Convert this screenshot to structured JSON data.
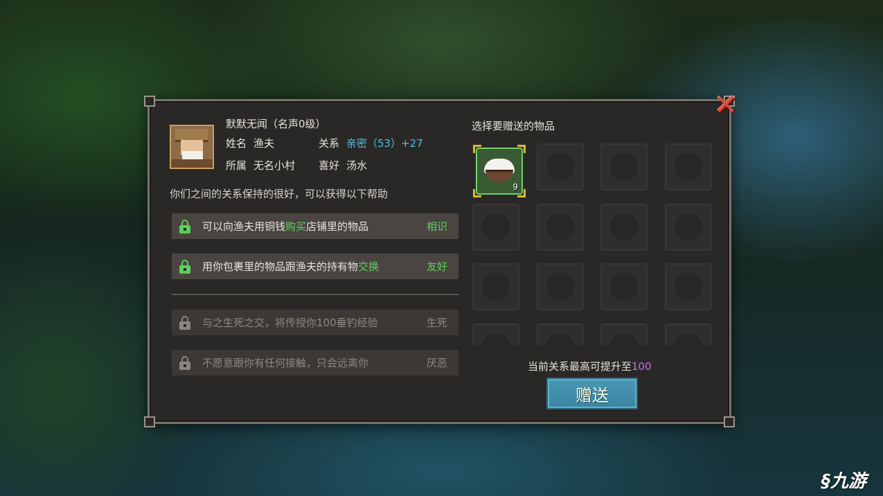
{
  "npc": {
    "title": "默默无闻（名声0级）",
    "name_label": "姓名",
    "name": "渔夫",
    "relation_label": "关系",
    "relation_value": "亲密（53）+27",
    "affiliation_label": "所属",
    "affiliation": "无名小村",
    "likes_label": "喜好",
    "likes": "汤水"
  },
  "description": "你们之间的关系保持的很好，可以获得以下帮助",
  "benefits": [
    {
      "pre": "可以向渔夫用铜钱",
      "highlight": "购买",
      "post": "店铺里的物品",
      "tag": "相识",
      "unlocked": true
    },
    {
      "pre": "用你包裹里的物品跟渔夫的持有物",
      "highlight": "交换",
      "post": "",
      "tag": "友好",
      "unlocked": true
    },
    {
      "pre": "与之生死之交，将传授你100垂钓经验",
      "highlight": "",
      "post": "",
      "tag": "生死",
      "unlocked": false
    },
    {
      "pre": "不愿意跟你有任何接触，只会远离你",
      "highlight": "",
      "post": "",
      "tag": "厌恶",
      "unlocked": false
    }
  ],
  "gift": {
    "title": "选择要赠送的物品",
    "selected_item": {
      "name": "rice-bowl-icon",
      "count": "9"
    },
    "max_text": "当前关系最高可提升至",
    "max_value": "100",
    "give_label": "赠送"
  },
  "watermark": "九游",
  "colors": {
    "highlight_green": "#5ed15e",
    "relation_cyan": "#4fc1d9",
    "max_purple": "#c070e0",
    "give_button": "#3a86a2",
    "close_red": "#d84a3a"
  }
}
